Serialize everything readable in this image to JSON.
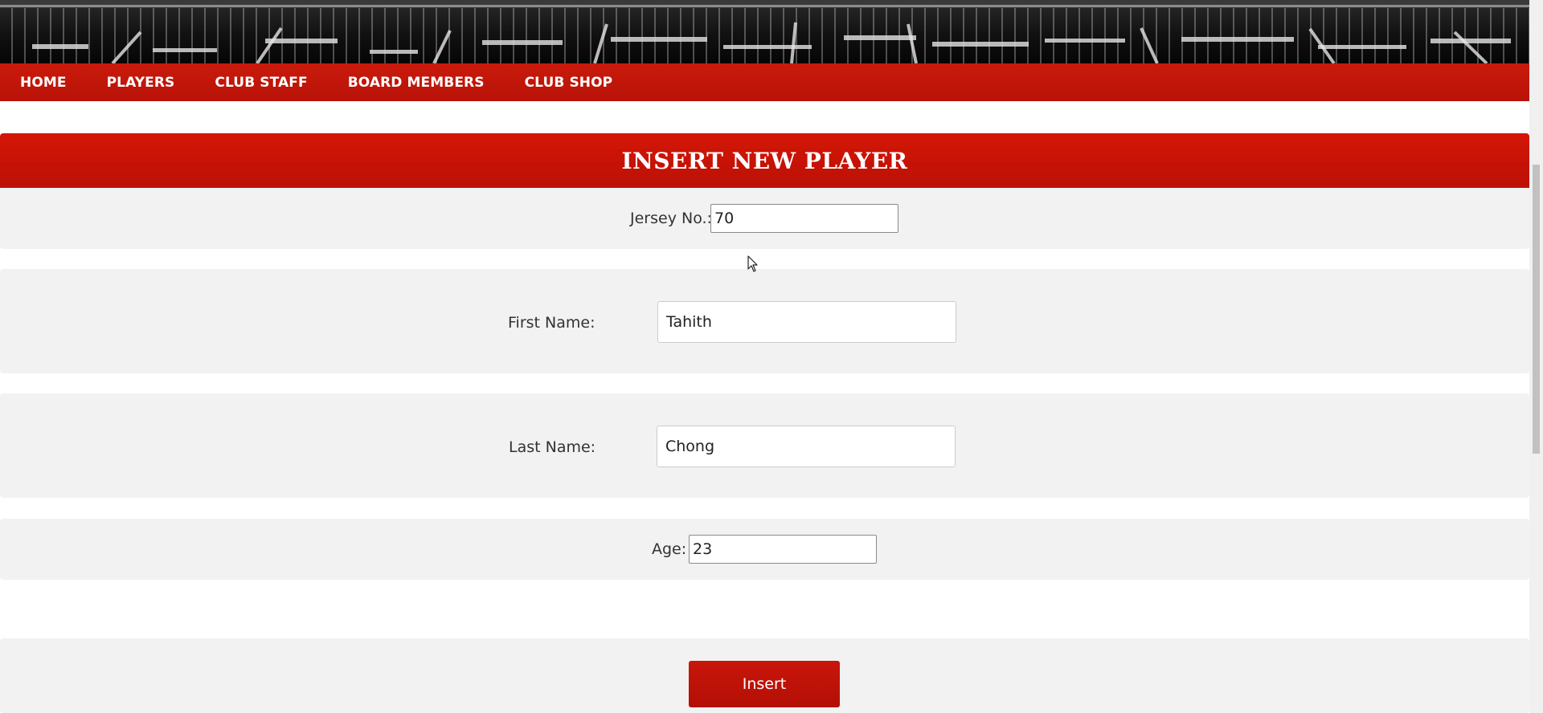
{
  "nav": {
    "items": [
      {
        "label": "HOME"
      },
      {
        "label": "PLAYERS"
      },
      {
        "label": "CLUB STAFF"
      },
      {
        "label": "BOARD MEMBERS"
      },
      {
        "label": "CLUB SHOP"
      }
    ]
  },
  "form": {
    "title": "INSERT NEW PLAYER",
    "jersey": {
      "label": "Jersey No.:",
      "value": "70"
    },
    "first_name": {
      "label": "First Name:",
      "value": "Tahith"
    },
    "last_name": {
      "label": "Last Name:",
      "value": "Chong"
    },
    "age": {
      "label": "Age:",
      "value": "23"
    },
    "submit_label": "Insert"
  },
  "colors": {
    "brand_red": "#c51206",
    "nav_red": "#c01508",
    "row_background": "#f2f2f2"
  },
  "icons": {
    "cursor": "mouse-pointer-icon"
  }
}
